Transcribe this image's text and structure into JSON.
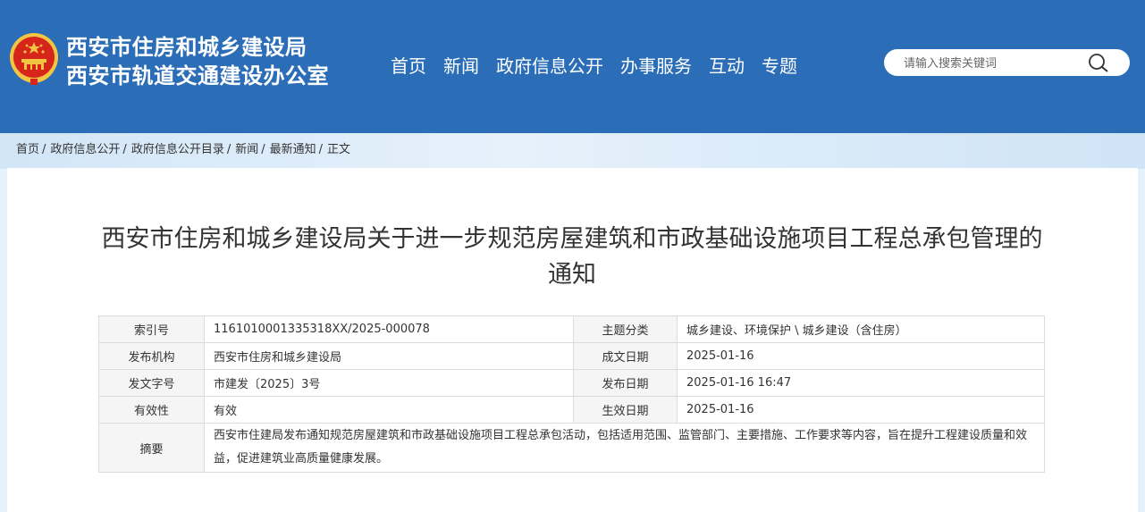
{
  "header": {
    "org_line1": "西安市住房和城乡建设局",
    "org_line2": "西安市轨道交通建设办公室",
    "colors": {
      "header_bg": "#2b6db7",
      "emblem_red": "#d6261c",
      "emblem_gold": "#f2c542"
    }
  },
  "nav": {
    "items": [
      "首页",
      "新闻",
      "政府信息公开",
      "办事服务",
      "互动",
      "专题"
    ]
  },
  "search": {
    "placeholder": "请输入搜索关键词",
    "icon": "search-icon"
  },
  "breadcrumb": {
    "items": [
      "首页",
      "政府信息公开",
      "政府信息公开目录",
      "新闻",
      "最新通知",
      "正文"
    ],
    "separator": "/"
  },
  "article": {
    "title": "西安市住房和城乡建设局关于进一步规范房屋建筑和市政基础设施项目工程总承包管理的通知",
    "meta": {
      "index_label": "索引号",
      "index_value": "1161010001335318XX/2025-000078",
      "topic_label": "主题分类",
      "topic_value": "城乡建设、环境保护 \\ 城乡建设（含住房）",
      "publisher_label": "发布机构",
      "publisher_value": "西安市住房和城乡建设局",
      "created_label": "成文日期",
      "created_value": "2025-01-16",
      "docno_label": "发文字号",
      "docno_value": "市建发〔2025〕3号",
      "pubdate_label": "发布日期",
      "pubdate_value": "2025-01-16 16:47",
      "validity_label": "有效性",
      "validity_value": "有效",
      "effective_label": "生效日期",
      "effective_value": "2025-01-16",
      "abstract_label": "摘要",
      "abstract_value": "西安市住建局发布通知规范房屋建筑和市政基础设施项目工程总承包活动，包括适用范围、监管部门、主要措施、工作要求等内容，旨在提升工程建设质量和效益，促进建筑业高质量健康发展。"
    }
  }
}
